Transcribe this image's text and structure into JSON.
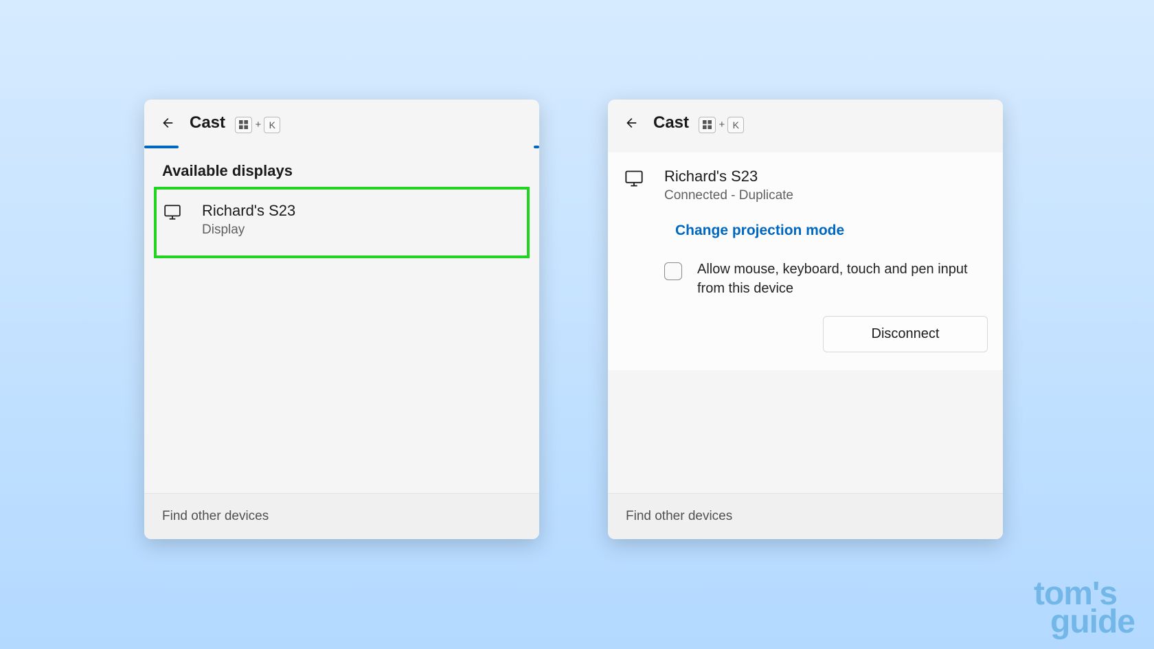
{
  "left": {
    "title": "Cast",
    "shortcut_key": "K",
    "available_heading": "Available displays",
    "device_name": "Richard's S23",
    "device_type": "Display",
    "footer": "Find other devices"
  },
  "right": {
    "title": "Cast",
    "shortcut_key": "K",
    "device_name": "Richard's S23",
    "device_status": "Connected - Duplicate",
    "change_mode": "Change projection mode",
    "allow_input": "Allow mouse, keyboard, touch and pen input from this device",
    "disconnect": "Disconnect",
    "footer": "Find other devices"
  },
  "watermark": {
    "line1": "tom's",
    "line2": "guide"
  },
  "colors": {
    "accent": "#0067c0",
    "highlight": "#20d420"
  }
}
